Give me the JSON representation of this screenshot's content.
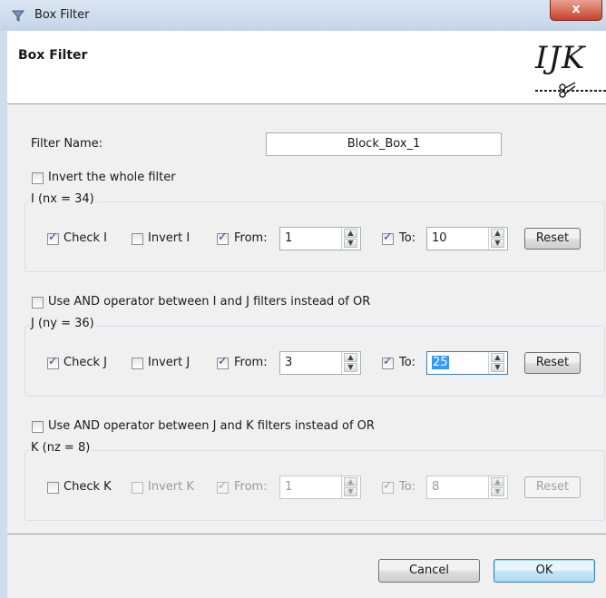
{
  "window": {
    "title": "Box Filter",
    "close_label": "x"
  },
  "header": {
    "title": "Box Filter",
    "logo_text": "IJK"
  },
  "filter_name": {
    "label": "Filter Name:",
    "value": "Block_Box_1"
  },
  "invert_whole": {
    "label": "Invert the whole filter",
    "checked": false
  },
  "group_i": {
    "legend": "I (nx = 34)",
    "check_label": "Check I",
    "check_checked": true,
    "invert_label": "Invert I",
    "invert_checked": false,
    "from_label": "From:",
    "from_checked": true,
    "from_value": "1",
    "to_label": "To:",
    "to_checked": true,
    "to_value": "10",
    "reset_label": "Reset"
  },
  "and_ij": {
    "label": "Use AND operator between I and J filters instead of OR",
    "checked": false
  },
  "group_j": {
    "legend": "J (ny = 36)",
    "check_label": "Check J",
    "check_checked": true,
    "invert_label": "Invert J",
    "invert_checked": false,
    "from_label": "From:",
    "from_checked": true,
    "from_value": "3",
    "to_label": "To:",
    "to_checked": true,
    "to_value": "25",
    "reset_label": "Reset"
  },
  "and_jk": {
    "label": "Use AND operator between J and K filters instead of OR",
    "checked": false
  },
  "group_k": {
    "legend": "K (nz = 8)",
    "check_label": "Check K",
    "check_checked": false,
    "invert_label": "Invert K",
    "invert_checked": false,
    "from_label": "From:",
    "from_checked": true,
    "from_value": "1",
    "to_label": "To:",
    "to_checked": true,
    "to_value": "8",
    "reset_label": "Reset",
    "disabled": true
  },
  "footer": {
    "cancel_label": "Cancel",
    "ok_label": "OK"
  },
  "icons": {
    "app": "filter-icon",
    "logo": "scissors-icon",
    "spin_up": "arrow-up-icon",
    "spin_down": "arrow-down-icon"
  }
}
